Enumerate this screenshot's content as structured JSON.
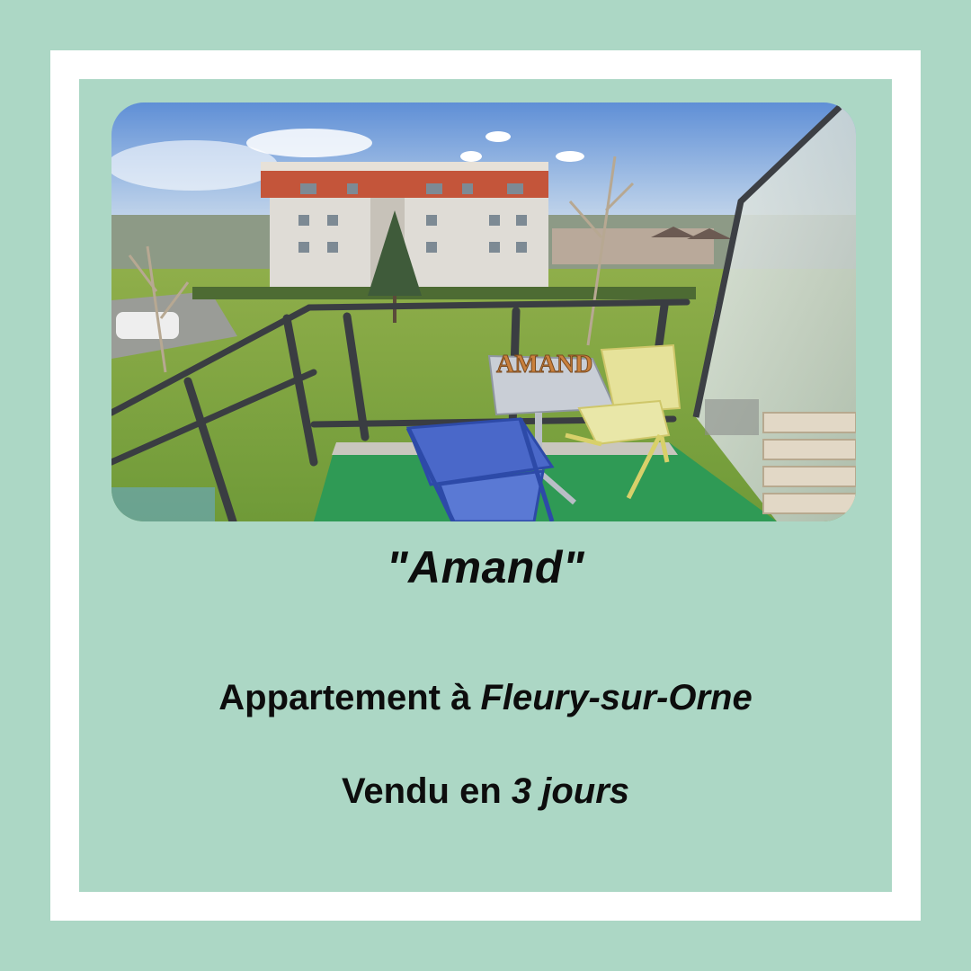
{
  "listing": {
    "name": "\"Amand\"",
    "property_prefix": "Appartement à",
    "location": "Fleury-sur-Orne",
    "sold_prefix": "Vendu en",
    "sold_duration": "3 jours",
    "photo_sign_text": "AMAND"
  },
  "colors": {
    "frame_green": "#acd7c5",
    "frame_white": "#ffffff",
    "text": "#0d0d0d"
  }
}
